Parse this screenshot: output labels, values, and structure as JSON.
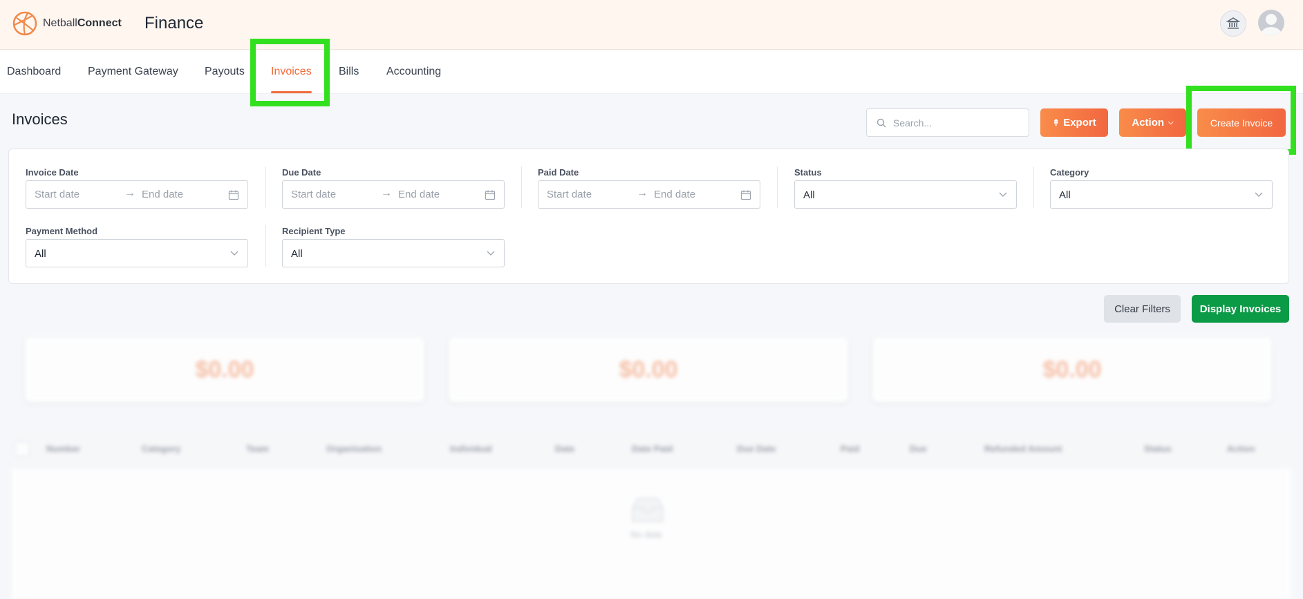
{
  "header": {
    "logo_text_light": "Netball",
    "logo_text_bold": "Connect",
    "app_title": "Finance",
    "icons": [
      "bank-icon",
      "user-avatar-icon"
    ]
  },
  "tabs": [
    {
      "label": "Dashboard",
      "active": false
    },
    {
      "label": "Payment Gateway",
      "active": false
    },
    {
      "label": "Payouts",
      "active": false
    },
    {
      "label": "Invoices",
      "active": true
    },
    {
      "label": "Bills",
      "active": false
    },
    {
      "label": "Accounting",
      "active": false
    }
  ],
  "page": {
    "title": "Invoices",
    "search_placeholder": "Search...",
    "export_label": "Export",
    "action_label": "Action",
    "create_label": "Create Invoice"
  },
  "filters": {
    "invoice_date": {
      "label": "Invoice Date",
      "start": "Start date",
      "end": "End date"
    },
    "due_date": {
      "label": "Due Date",
      "start": "Start date",
      "end": "End date"
    },
    "paid_date": {
      "label": "Paid Date",
      "start": "Start date",
      "end": "End date"
    },
    "status": {
      "label": "Status",
      "value": "All"
    },
    "category": {
      "label": "Category",
      "value": "All"
    },
    "payment_method": {
      "label": "Payment Method",
      "value": "All"
    },
    "recipient_type": {
      "label": "Recipient Type",
      "value": "All"
    }
  },
  "actions": {
    "clear_label": "Clear Filters",
    "display_label": "Display Invoices"
  },
  "summary_cards": [
    "$0.00",
    "$0.00",
    "$0.00"
  ],
  "table": {
    "columns": [
      "Number",
      "Category",
      "Team",
      "Organisation",
      "Individual",
      "Date",
      "Date Paid",
      "Due Date",
      "Paid",
      "Due",
      "Refunded Amount",
      "Status",
      "Action"
    ],
    "empty_text": "No data"
  },
  "colors": {
    "accent": "#f26b3a",
    "green": "#0b9a46",
    "highlight": "#33e01f"
  }
}
